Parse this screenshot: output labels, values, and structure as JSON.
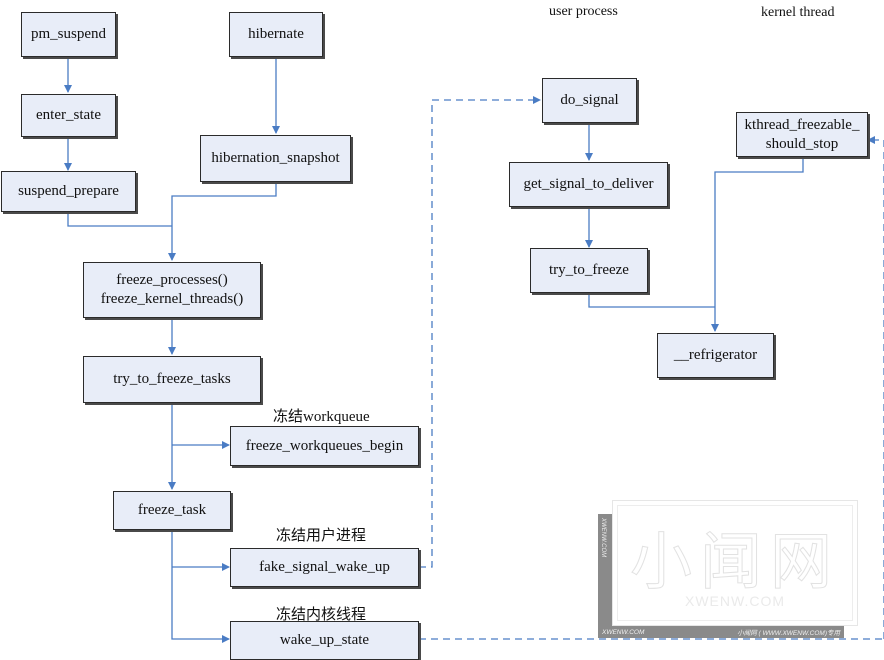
{
  "diagram": {
    "column_headers": {
      "user_process": "user process",
      "kernel_thread": "kernel thread"
    },
    "nodes": {
      "pm_suspend": "pm_suspend",
      "enter_state": "enter_state",
      "suspend_prepare": "suspend_prepare",
      "hibernate": "hibernate",
      "hibernation_snapshot": "hibernation_snapshot",
      "freeze_processes": "freeze_processes()\nfreeze_kernel_threads()",
      "try_to_freeze_tasks": "try_to_freeze_tasks",
      "freeze_workqueues_begin": "freeze_workqueues_begin",
      "freeze_task": "freeze_task",
      "fake_signal_wake_up": "fake_signal_wake_up",
      "wake_up_state": "wake_up_state",
      "do_signal": "do_signal",
      "get_signal_to_deliver": "get_signal_to_deliver",
      "try_to_freeze": "try_to_freeze",
      "kthread_freezable_should_stop": "kthread_freezable_\nshould_stop",
      "refrigerator": "__refrigerator"
    },
    "annotations": {
      "freeze_workqueue": "冻结workqueue",
      "freeze_user_process": "冻结用户进程",
      "freeze_kernel_thread": "冻结内核线程"
    },
    "edges": [
      {
        "from": "pm_suspend",
        "to": "enter_state",
        "style": "solid"
      },
      {
        "from": "enter_state",
        "to": "suspend_prepare",
        "style": "solid"
      },
      {
        "from": "hibernate",
        "to": "hibernation_snapshot",
        "style": "solid"
      },
      {
        "from": "suspend_prepare",
        "to": "freeze_processes",
        "style": "solid"
      },
      {
        "from": "hibernation_snapshot",
        "to": "freeze_processes",
        "style": "solid"
      },
      {
        "from": "freeze_processes",
        "to": "try_to_freeze_tasks",
        "style": "solid"
      },
      {
        "from": "try_to_freeze_tasks",
        "to": "freeze_workqueues_begin",
        "style": "solid"
      },
      {
        "from": "try_to_freeze_tasks",
        "to": "freeze_task",
        "style": "solid"
      },
      {
        "from": "freeze_task",
        "to": "fake_signal_wake_up",
        "style": "solid"
      },
      {
        "from": "freeze_task",
        "to": "wake_up_state",
        "style": "solid"
      },
      {
        "from": "fake_signal_wake_up",
        "to": "do_signal",
        "style": "dashed"
      },
      {
        "from": "wake_up_state",
        "to": "kthread_freezable_should_stop",
        "style": "dashed"
      },
      {
        "from": "do_signal",
        "to": "get_signal_to_deliver",
        "style": "solid"
      },
      {
        "from": "get_signal_to_deliver",
        "to": "try_to_freeze",
        "style": "solid"
      },
      {
        "from": "try_to_freeze",
        "to": "refrigerator",
        "style": "solid"
      },
      {
        "from": "kthread_freezable_should_stop",
        "to": "refrigerator",
        "style": "solid"
      }
    ],
    "watermark": {
      "big_text": "小闻网",
      "url": "XWENW.COM",
      "side_text": "XWENW.COM",
      "bottom_left": "XWENW.COM",
      "bottom_right": "小闻网 ( WWW.XWENW.COM)专用"
    },
    "colors": {
      "node_fill": "#e8edf8",
      "node_border": "#2b2b2b",
      "edge": "#4a7cc4"
    }
  }
}
